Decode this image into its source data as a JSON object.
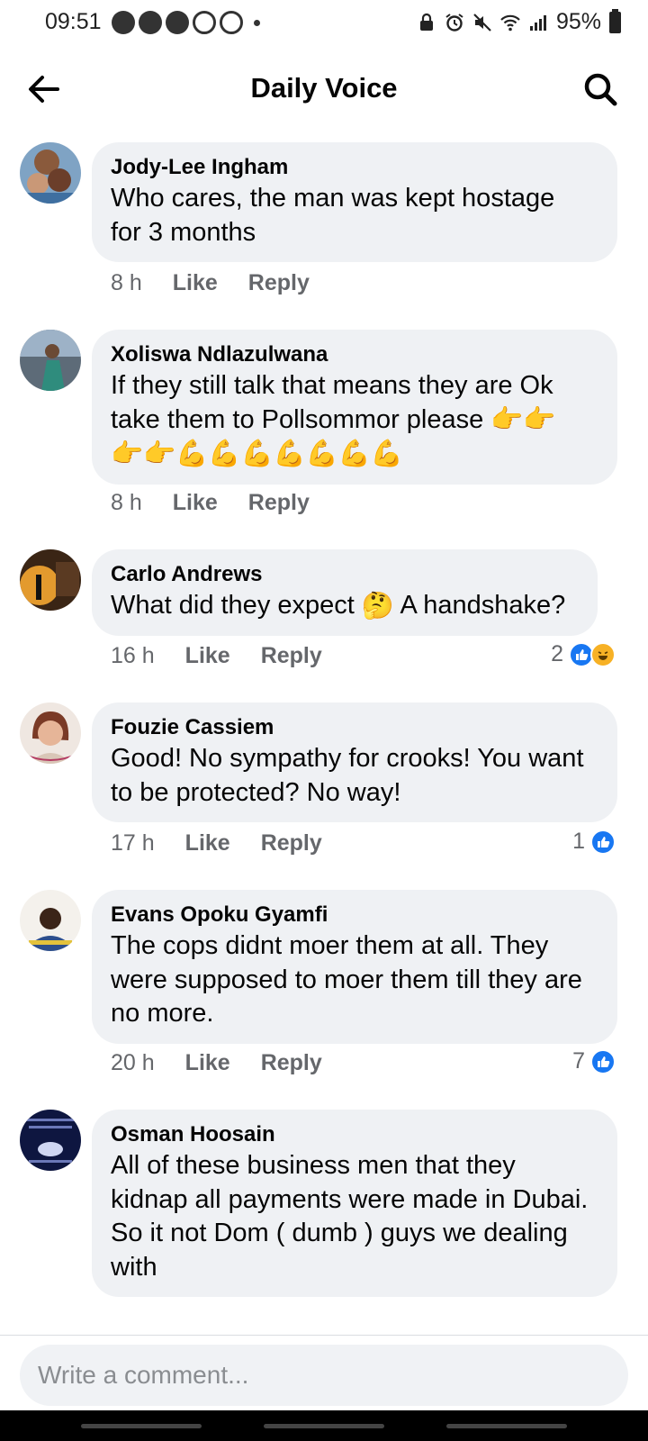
{
  "status_bar": {
    "time": "09:51",
    "battery": "95%",
    "left_icons": [
      "messenger-icon",
      "messenger-icon",
      "messenger-icon",
      "recycle-icon",
      "recycle-icon"
    ],
    "right_icons": [
      "lock-icon",
      "alarm-icon",
      "mute-icon",
      "wifi-icon",
      "signal-icon",
      "battery-icon"
    ]
  },
  "header": {
    "title": "Daily Voice"
  },
  "actions": {
    "like": "Like",
    "reply": "Reply"
  },
  "comments": [
    {
      "author": "Jody-Lee Ingham",
      "lines": [
        "Who cares, the man was kept hostage",
        "for 3 months"
      ],
      "time": "8 h",
      "reactions": null
    },
    {
      "author": "Xoliswa Ndlazulwana",
      "lines": [
        "If they still talk that means they are Ok",
        "take them to Pollsommor please"
      ],
      "emoji_line1": [
        "👉",
        "👉"
      ],
      "emoji_line2": [
        "👉",
        "👉",
        "💪",
        "💪",
        "💪",
        "💪",
        "💪",
        "💪",
        "💪"
      ],
      "time": "8 h",
      "reactions": null
    },
    {
      "author": "Carlo Andrews",
      "lines": [
        "What did they expect",
        "A handshake?"
      ],
      "emoji_inline": "🤔",
      "time": "16 h",
      "reactions": {
        "count": "2",
        "types": [
          "like",
          "haha"
        ]
      }
    },
    {
      "author": "Fouzie Cassiem",
      "lines": [
        "Good! No sympathy for crooks! You want",
        "to be protected? No way!"
      ],
      "time": "17 h",
      "reactions": {
        "count": "1",
        "types": [
          "like"
        ]
      }
    },
    {
      "author": "Evans Opoku Gyamfi",
      "lines": [
        "The cops didnt moer them at all. They",
        "were supposed to moer them till they are",
        "no more."
      ],
      "time": "20 h",
      "reactions": {
        "count": "7",
        "types": [
          "like"
        ]
      }
    },
    {
      "author": "Osman Hoosain",
      "lines": [
        "All of these business men that they",
        "kidnap all payments were made in Dubai.",
        "So it not Dom ( dumb ) guys we dealing",
        "with"
      ],
      "time": "",
      "reactions": null
    }
  ],
  "composer": {
    "placeholder": "Write a comment..."
  },
  "colors": {
    "bubble": "#eff1f4",
    "meta_text": "#65676b",
    "like_blue": "#1877f2",
    "haha_yellow": "#f7b125"
  }
}
